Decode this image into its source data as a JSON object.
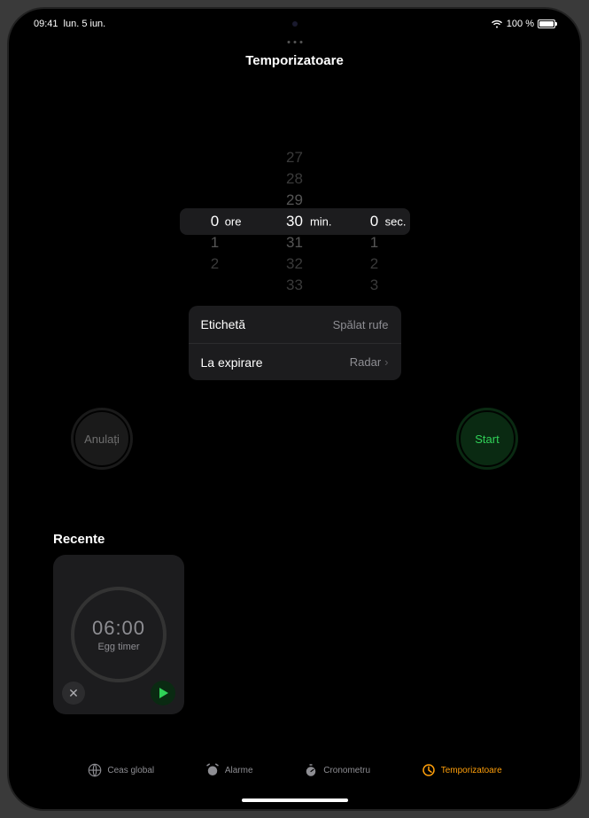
{
  "status": {
    "time": "09:41",
    "date": "lun. 5 iun.",
    "battery_pct": "100 %"
  },
  "title": "Temporizatoare",
  "picker": {
    "hours": {
      "selected": "0",
      "unit": "ore",
      "below": [
        "1",
        "2"
      ]
    },
    "minutes": {
      "above": [
        "27",
        "28",
        "29"
      ],
      "selected": "30",
      "unit": "min.",
      "below": [
        "31",
        "32",
        "33"
      ]
    },
    "seconds": {
      "selected": "0",
      "unit": "sec.",
      "below": [
        "1",
        "2",
        "3"
      ]
    }
  },
  "settings": {
    "label_key": "Etichetă",
    "label_value": "Spălat rufe",
    "end_key": "La expirare",
    "end_value": "Radar"
  },
  "buttons": {
    "cancel": "Anulați",
    "start": "Start"
  },
  "recents": {
    "title": "Recente",
    "items": [
      {
        "time": "06:00",
        "label": "Egg timer"
      }
    ]
  },
  "tabs": {
    "world": "Ceas global",
    "alarms": "Alarme",
    "stopwatch": "Cronometru",
    "timers": "Temporizatoare"
  }
}
